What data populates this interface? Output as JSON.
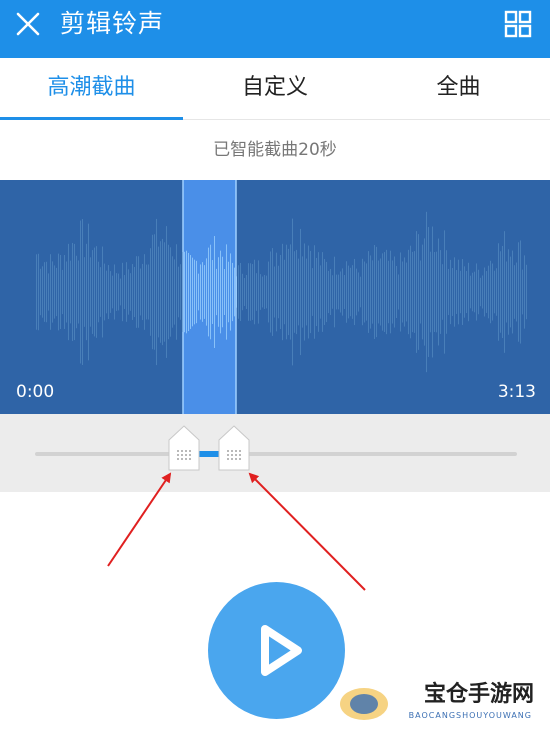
{
  "header": {
    "title": "剪辑铃声",
    "close_icon": "close-icon",
    "menu_icon": "grid-icon",
    "bg_color": "#1e8fe8"
  },
  "tabs": [
    {
      "label": "高潮截曲",
      "active": true
    },
    {
      "label": "自定义",
      "active": false
    },
    {
      "label": "全曲",
      "active": false
    }
  ],
  "hint": "已智能截曲20秒",
  "waveform": {
    "start_time": "0:00",
    "end_time": "3:13",
    "bg_color": "#2f64a7",
    "selection_color": "#4a8fe8"
  },
  "slider": {
    "selection_start_fraction": 0.3,
    "selection_end_fraction": 0.41
  },
  "play_button": {
    "icon": "play-icon",
    "color": "#4aa6ee"
  },
  "watermark": {
    "text": "宝仓手游网",
    "sub": "BAOCANGSHOUYOUWANG"
  },
  "annotation_color": "#e02020"
}
